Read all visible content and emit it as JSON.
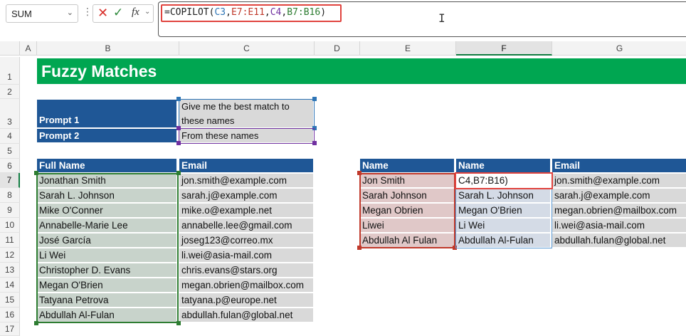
{
  "formula_bar": {
    "name_box": "SUM",
    "formula_parts": [
      {
        "text": "=COPILOT(",
        "color": "#222222"
      },
      {
        "text": "C3",
        "color": "#2e75b6"
      },
      {
        "text": ",",
        "color": "#222222"
      },
      {
        "text": "E7:E11",
        "color": "#c0392b"
      },
      {
        "text": ",",
        "color": "#222222"
      },
      {
        "text": "C4",
        "color": "#7030a0"
      },
      {
        "text": ",",
        "color": "#222222"
      },
      {
        "text": "B7:B16",
        "color": "#2e7d32"
      },
      {
        "text": ")",
        "color": "#222222"
      }
    ],
    "icons": [
      "x-icon",
      "check-icon",
      "fx-icon",
      "chevron-down-icon",
      "kebab-icon",
      "text-cursor-icon"
    ]
  },
  "columns": [
    "A",
    "B",
    "C",
    "D",
    "E",
    "F",
    "G"
  ],
  "selected_column": "F",
  "rows": [
    "1",
    "2",
    "3",
    "4",
    "5",
    "6",
    "7",
    "8",
    "9",
    "10",
    "11",
    "12",
    "13",
    "14",
    "15",
    "16",
    "17"
  ],
  "selected_row": "7",
  "sheet": {
    "title": "Fuzzy Matches",
    "prompt1_label": "Prompt 1",
    "prompt1_text_line1": "Give me the best match to",
    "prompt1_text_line2": "these names",
    "prompt2_label": "Prompt 2",
    "prompt2_text": "From these names",
    "left_table": {
      "headers": [
        "Full Name",
        "Email"
      ],
      "rows": [
        [
          "Jonathan Smith",
          "jon.smith@example.com"
        ],
        [
          "Sarah L. Johnson",
          "sarah.j@example.com"
        ],
        [
          "Mike O'Conner",
          "mike.o@example.net"
        ],
        [
          "Annabelle-Marie Lee",
          "annabelle.lee@gmail.com"
        ],
        [
          "José García",
          "joseg123@correo.mx"
        ],
        [
          "Li Wei",
          "li.wei@asia-mail.com"
        ],
        [
          "Christopher D. Evans",
          "chris.evans@stars.org"
        ],
        [
          "Megan O'Brien",
          "megan.obrien@mailbox.com"
        ],
        [
          "Tatyana Petrova",
          "tatyana.p@europe.net"
        ],
        [
          "Abdullah Al-Fulan",
          "abdullah.fulan@global.net"
        ]
      ]
    },
    "right_table": {
      "headers": [
        "Name",
        "Name",
        "Email"
      ],
      "rows": [
        [
          "Jon Smith",
          "C4,B7:B16)",
          "jon.smith@example.com"
        ],
        [
          "Sarah Johnson",
          "Sarah L. Johnson",
          "sarah.j@example.com"
        ],
        [
          "Megan Obrien",
          "Megan O'Brien",
          "megan.obrien@mailbox.com"
        ],
        [
          "Liwei",
          "Li Wei",
          "li.wei@asia-mail.com"
        ],
        [
          "Abdullah Al Fulan",
          "Abdullah Al-Fulan",
          "abdullah.fulan@global.net"
        ]
      ]
    }
  },
  "colors": {
    "banner": "#00a651",
    "header_fill": "#1f5796",
    "cell_fill": "#d9d9d9",
    "ref_c3": "#2e75b6",
    "ref_e7_e11": "#c0392b",
    "ref_c4": "#7030a0",
    "ref_b7_b16": "#2e7d32",
    "highlight_red": "#e0433e"
  }
}
